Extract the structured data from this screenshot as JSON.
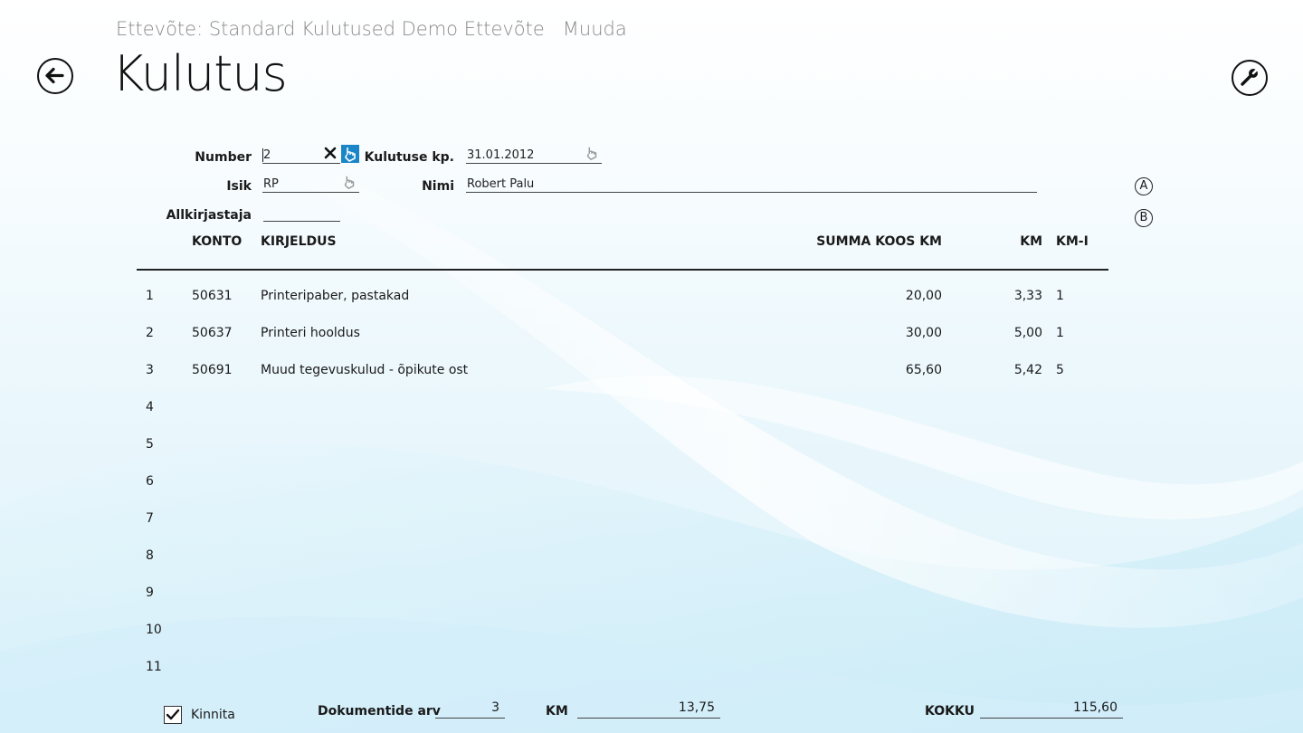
{
  "header": {
    "company_label": "Ettevõte: Standard Kulutused Demo Ettevõte",
    "mode_label": "Muuda",
    "title": "Kulutus"
  },
  "form": {
    "number_label": "Number",
    "number_value": "2",
    "date_label": "Kulutuse kp.",
    "date_value": "31.01.2012",
    "isik_label": "Isik",
    "isik_value": "RP",
    "nimi_label": "Nimi",
    "nimi_value": "Robert Palu",
    "allkirjastaja_label": "Allkirjastaja",
    "allkirjastaja_value": ""
  },
  "side_buttons": {
    "a": "A",
    "b": "B"
  },
  "table": {
    "headers": {
      "konto": "KONTO",
      "kirjeldus": "KIRJELDUS",
      "summa": "SUMMA KOOS KM",
      "km": "KM",
      "kmi": "KM-I"
    },
    "rows": [
      {
        "n": "1",
        "konto": "50631",
        "kirjeldus": "Printeripaber, pastakad",
        "summa": "20,00",
        "km": "3,33",
        "kmi": "1"
      },
      {
        "n": "2",
        "konto": "50637",
        "kirjeldus": "Printeri hooldus",
        "summa": "30,00",
        "km": "5,00",
        "kmi": "1"
      },
      {
        "n": "3",
        "konto": "50691",
        "kirjeldus": "Muud tegevuskulud - õpikute ost",
        "summa": "65,60",
        "km": "5,42",
        "kmi": "5"
      },
      {
        "n": "4",
        "konto": "",
        "kirjeldus": "",
        "summa": "",
        "km": "",
        "kmi": ""
      },
      {
        "n": "5",
        "konto": "",
        "kirjeldus": "",
        "summa": "",
        "km": "",
        "kmi": ""
      },
      {
        "n": "6",
        "konto": "",
        "kirjeldus": "",
        "summa": "",
        "km": "",
        "kmi": ""
      },
      {
        "n": "7",
        "konto": "",
        "kirjeldus": "",
        "summa": "",
        "km": "",
        "kmi": ""
      },
      {
        "n": "8",
        "konto": "",
        "kirjeldus": "",
        "summa": "",
        "km": "",
        "kmi": ""
      },
      {
        "n": "9",
        "konto": "",
        "kirjeldus": "",
        "summa": "",
        "km": "",
        "kmi": ""
      },
      {
        "n": "10",
        "konto": "",
        "kirjeldus": "",
        "summa": "",
        "km": "",
        "kmi": ""
      },
      {
        "n": "11",
        "konto": "",
        "kirjeldus": "",
        "summa": "",
        "km": "",
        "kmi": ""
      }
    ]
  },
  "footer": {
    "kinnita_label": "Kinnita",
    "kinnita_checked": true,
    "dok_label": "Dokumentide arv",
    "dok_value": "3",
    "km_label": "KM",
    "km_value": "13,75",
    "kokku_label": "KOKKU",
    "kokku_value": "115,60"
  },
  "colors": {
    "accent": "#1a86c8",
    "background": "#e6f6fc"
  }
}
